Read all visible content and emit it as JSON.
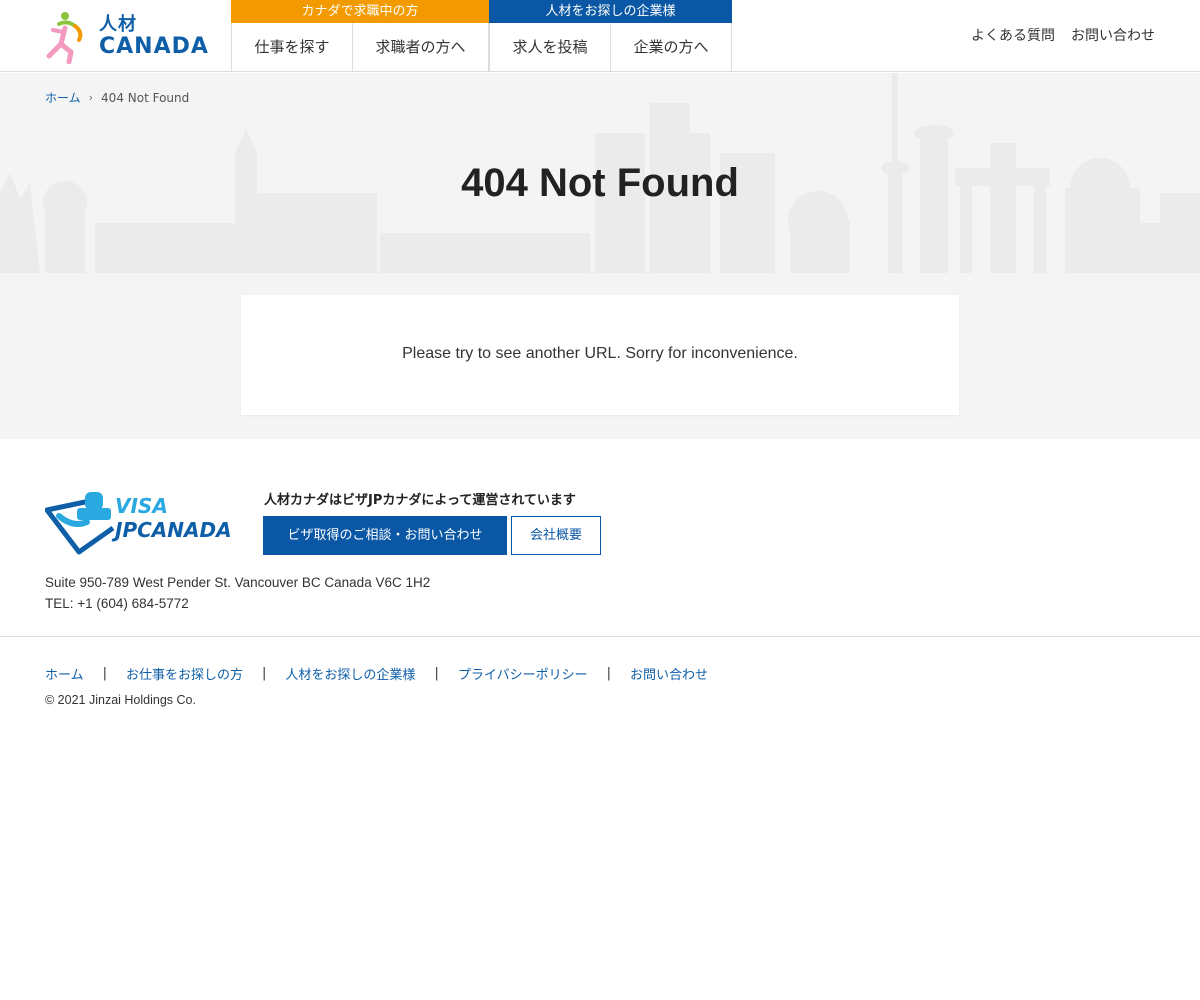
{
  "header": {
    "logo": {
      "jp": "人材",
      "en": "CANADA"
    },
    "nav_groups": [
      {
        "label": "カナダで求職中の方",
        "color": "#f39a00",
        "items": [
          "仕事を探す",
          "求職者の方へ"
        ]
      },
      {
        "label": "人材をお探しの企業様",
        "color": "#0a57a5",
        "items": [
          "求人を投稿",
          "企業の方へ"
        ]
      }
    ],
    "util_links": [
      "よくある質問",
      "お問い合わせ"
    ]
  },
  "breadcrumb": {
    "home": "ホーム",
    "current": "404 Not Found"
  },
  "page": {
    "title": "404 Not Found",
    "message": "Please try to see another URL. Sorry for inconvenience."
  },
  "footer": {
    "visa_logo": {
      "line1": "VISA",
      "line2": "JPCANADA"
    },
    "operated_by": "人材カナダはビザJPカナダによって運営されています",
    "consult_button": "ビザ取得のご相談・お問い合わせ",
    "company_button": "会社概要",
    "address": "Suite 950-789 West Pender St. Vancouver BC Canada V6C 1H2",
    "tel": "TEL: +1 (604) 684-5772",
    "links": [
      "ホーム",
      "お仕事をお探しの方",
      "人材をお探しの企業様",
      "プライバシーポリシー",
      "お問い合わせ"
    ],
    "link_divider": "|",
    "copyright": "© 2021 Jinzai Holdings Co."
  },
  "colors": {
    "brand_blue": "#0a57a5",
    "brand_orange": "#f39a00",
    "hero_bg": "#f4f4f4",
    "visa_light_blue": "#2aa8e0"
  }
}
